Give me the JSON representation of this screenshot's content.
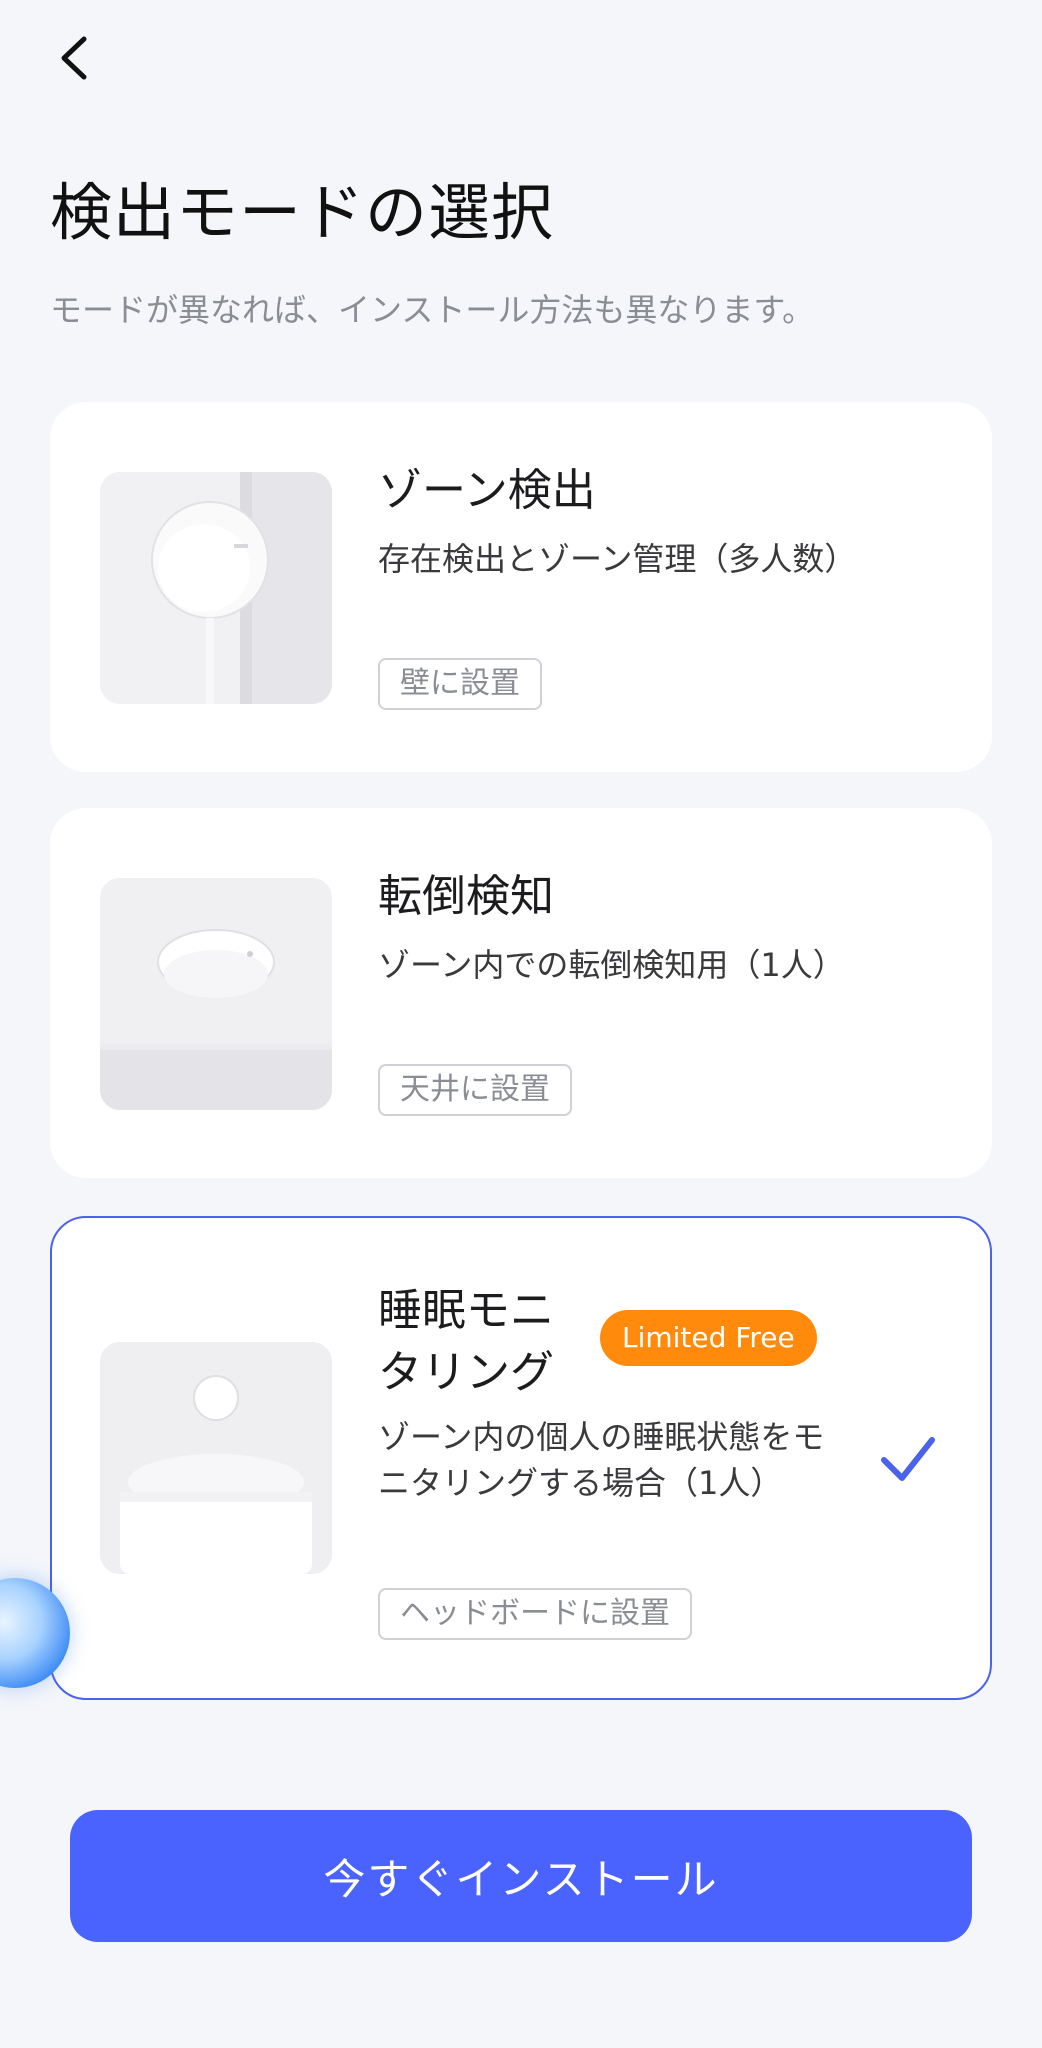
{
  "header": {
    "back_icon": "chevron-left-icon",
    "title": "検出モードの選択",
    "subtitle": "モードが異なれば、インストール方法も異なります。"
  },
  "modes": [
    {
      "title": "ゾーン検出",
      "description": "存在検出とゾーン管理（多人数）",
      "tag": "壁に設置",
      "selected": false
    },
    {
      "title": "転倒検知",
      "description": "ゾーン内での転倒検知用（1人）",
      "tag": "天井に設置",
      "selected": false
    },
    {
      "title": "睡眠モニタリング",
      "badge": "Limited Free",
      "description": "ゾーン内の個人の睡眠状態をモニタリングする場合（1人）",
      "tag": "ヘッドボードに設置",
      "selected": true
    }
  ],
  "install_button": "今すぐインストール",
  "colors": {
    "accent": "#4a63ff",
    "badge": "#ff8a0b",
    "selected_border": "#4a63e8",
    "background": "#f4f6fa"
  }
}
